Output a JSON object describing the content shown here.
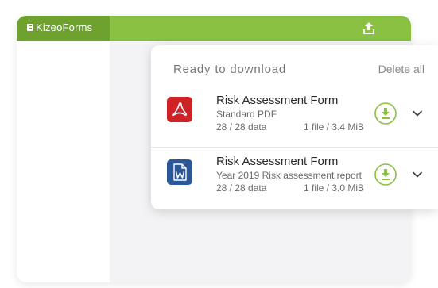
{
  "app": {
    "brand": "KizeoForms",
    "accent_color": "#8ac142",
    "brand_cell_color": "#6fa12f"
  },
  "topbar": {
    "upload_icon": "upload-icon"
  },
  "downloads": {
    "title": "Ready to download",
    "delete_all_label": "Delete all",
    "items": [
      {
        "name": "Risk Assessment Form",
        "subtitle": "Standard PDF",
        "data_count": "28 / 28 data",
        "file_info": "1 file / 3.4 MiB",
        "file_type_icon": "pdf-file-icon",
        "file_type_color": "#cf2128"
      },
      {
        "name": "Risk Assessment Form",
        "subtitle": "Year 2019 Risk assessment report",
        "data_count": "28 / 28 data",
        "file_info": "1 file / 3.0 MiB",
        "file_type_icon": "word-file-icon",
        "file_type_color": "#2b5797"
      }
    ]
  }
}
